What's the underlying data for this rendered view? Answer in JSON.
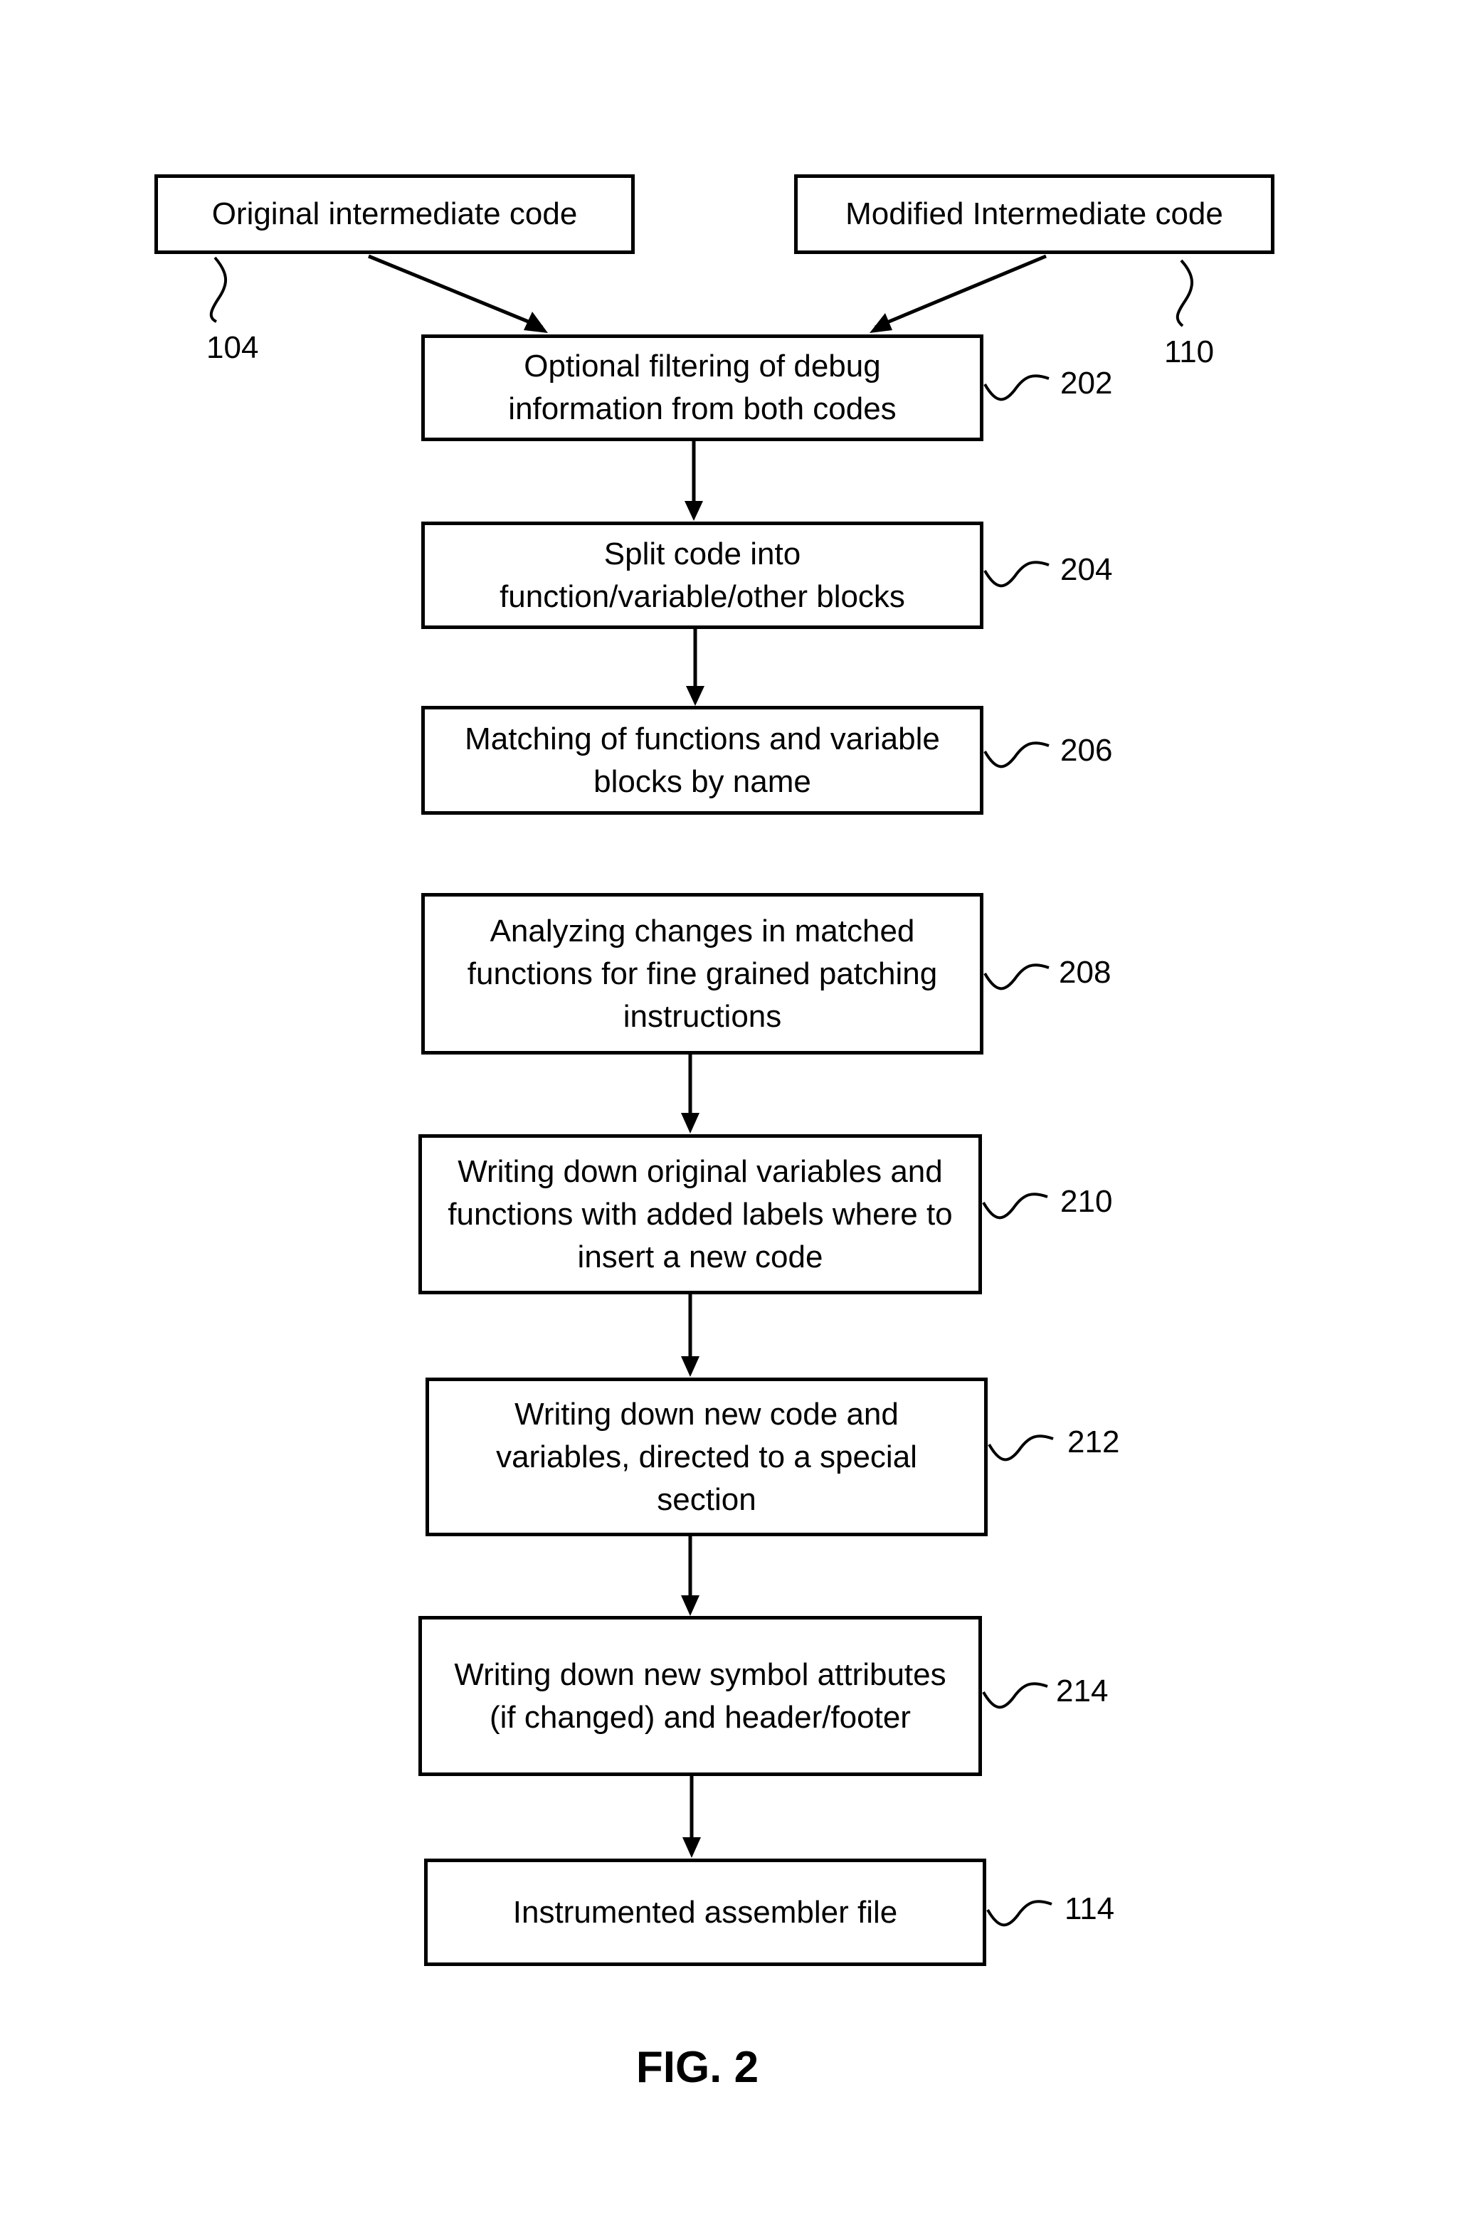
{
  "figure_label": "FIG. 2",
  "nodes": {
    "orig": {
      "text": "Original intermediate code",
      "ref": "104"
    },
    "mod": {
      "text": "Modified Intermediate code",
      "ref": "110"
    },
    "s202": {
      "text": "Optional filtering of debug\ninformation from both codes",
      "ref": "202"
    },
    "s204": {
      "text": "Split code into\nfunction/variable/other blocks",
      "ref": "204"
    },
    "s206": {
      "text": "Matching of functions and variable\nblocks by name",
      "ref": "206"
    },
    "s208": {
      "text": "Analyzing changes in matched\nfunctions for fine grained patching\ninstructions",
      "ref": "208"
    },
    "s210": {
      "text": "Writing down original variables and\nfunctions with added labels where to\ninsert a new code",
      "ref": "210"
    },
    "s212": {
      "text": "Writing down new code and\nvariables, directed to a special\nsection",
      "ref": "212"
    },
    "s214": {
      "text": "Writing down new symbol attributes\n(if changed) and header/footer",
      "ref": "214"
    },
    "s114": {
      "text": "Instrumented assembler file",
      "ref": "114"
    }
  },
  "edges": [
    {
      "from": "orig",
      "to": "s202"
    },
    {
      "from": "mod",
      "to": "s202"
    },
    {
      "from": "s202",
      "to": "s204"
    },
    {
      "from": "s204",
      "to": "s206"
    },
    {
      "from": "s208",
      "to": "s210"
    },
    {
      "from": "s210",
      "to": "s212"
    },
    {
      "from": "s212",
      "to": "s214"
    },
    {
      "from": "s214",
      "to": "s114"
    }
  ]
}
